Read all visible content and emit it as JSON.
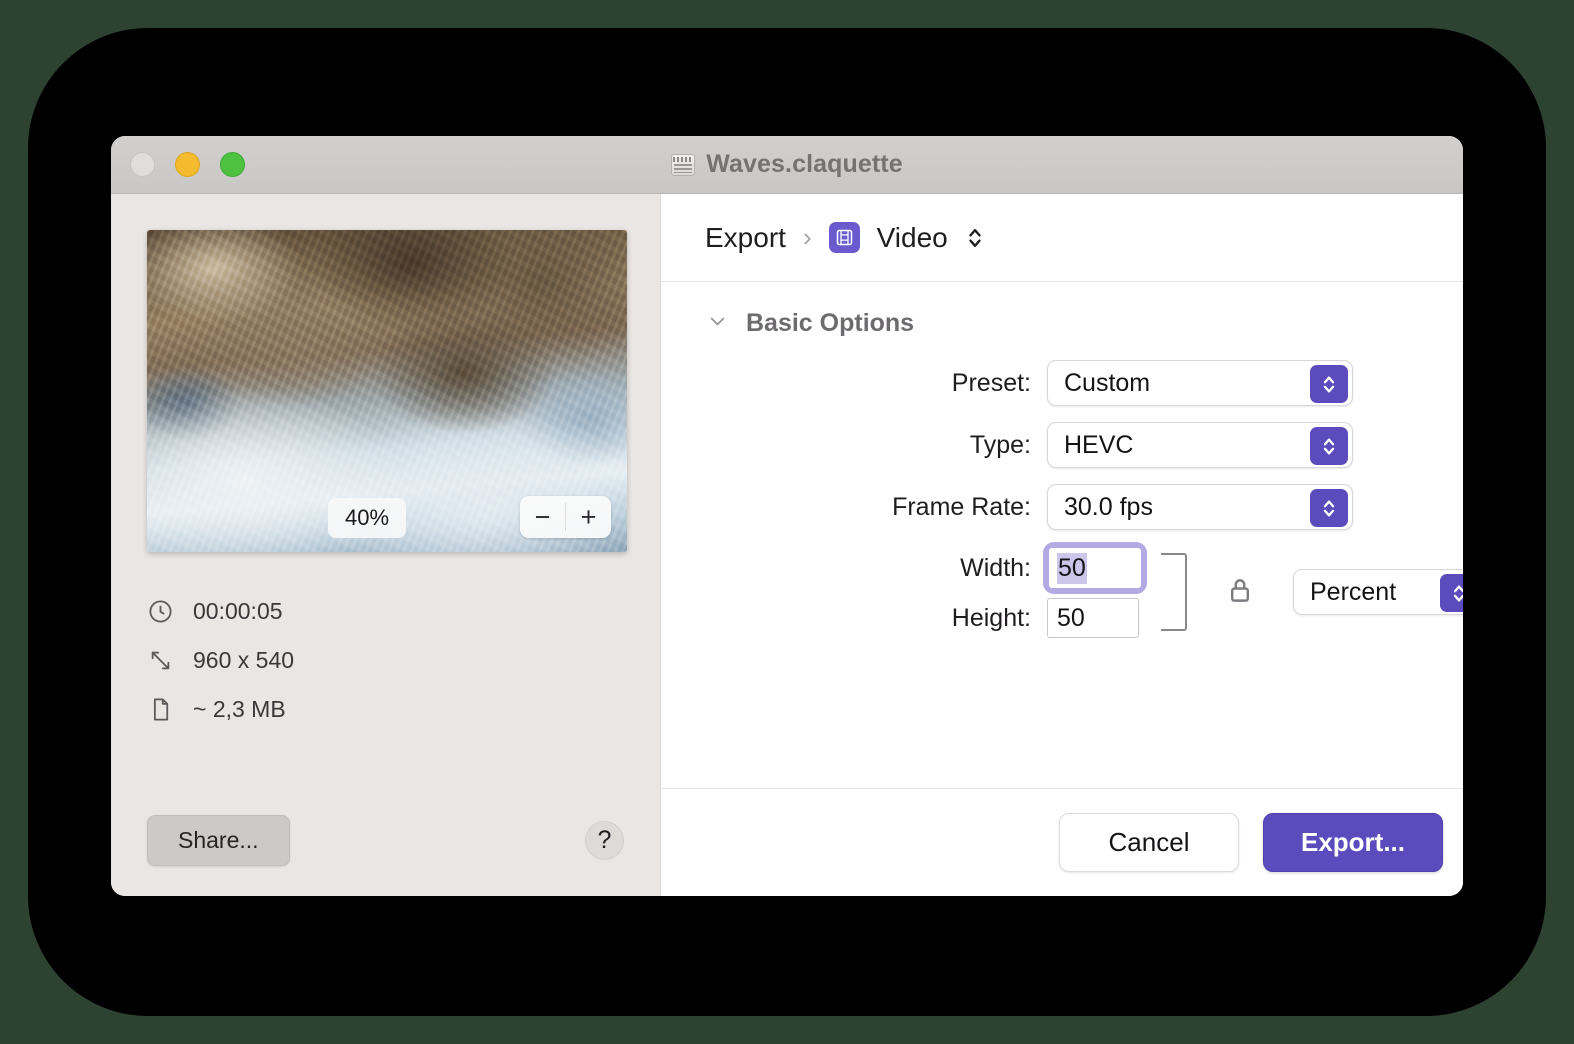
{
  "window": {
    "title": "Waves.claquette",
    "doc_icon": "clapperboard-icon",
    "traffic_lights": {
      "close": "close",
      "minimize": "minimize",
      "maximize": "maximize"
    }
  },
  "preview": {
    "zoom_level": "40%",
    "zoom_out_label": "−",
    "zoom_in_label": "+",
    "image_description": "Aerial photo of rocky coastline with white foaming waves"
  },
  "metadata": [
    {
      "icon": "clock-icon",
      "value": "00:00:05"
    },
    {
      "icon": "resize-icon",
      "value": "960 x 540"
    },
    {
      "icon": "document-icon",
      "value": "~ 2,3 MB"
    }
  ],
  "left_actions": {
    "share_label": "Share...",
    "help_label": "?"
  },
  "breadcrumb": {
    "root": "Export",
    "separator": "›",
    "current": "Video",
    "current_icon": "film-strip-icon"
  },
  "section": {
    "disclosure_icon": "chevron-down-icon",
    "title": "Basic Options"
  },
  "fields": {
    "preset": {
      "label": "Preset:",
      "value": "Custom"
    },
    "type": {
      "label": "Type:",
      "value": "HEVC"
    },
    "frame_rate": {
      "label": "Frame Rate:",
      "value": "30.0 fps"
    },
    "width": {
      "label": "Width:",
      "value": "50",
      "focused": true,
      "selected": true
    },
    "height": {
      "label": "Height:",
      "value": "50"
    },
    "unit": {
      "value": "Percent"
    },
    "lock": {
      "icon": "lock-closed-icon",
      "state": "locked"
    }
  },
  "footer": {
    "cancel_label": "Cancel",
    "export_label": "Export..."
  },
  "colors": {
    "accent_purple": "#5b4bbd",
    "focus_ring": "#b3aae4",
    "left_panel_bg": "#eae6e4",
    "titlebar_bg": "#cecccb",
    "desktop_bg": "#2e4232"
  }
}
